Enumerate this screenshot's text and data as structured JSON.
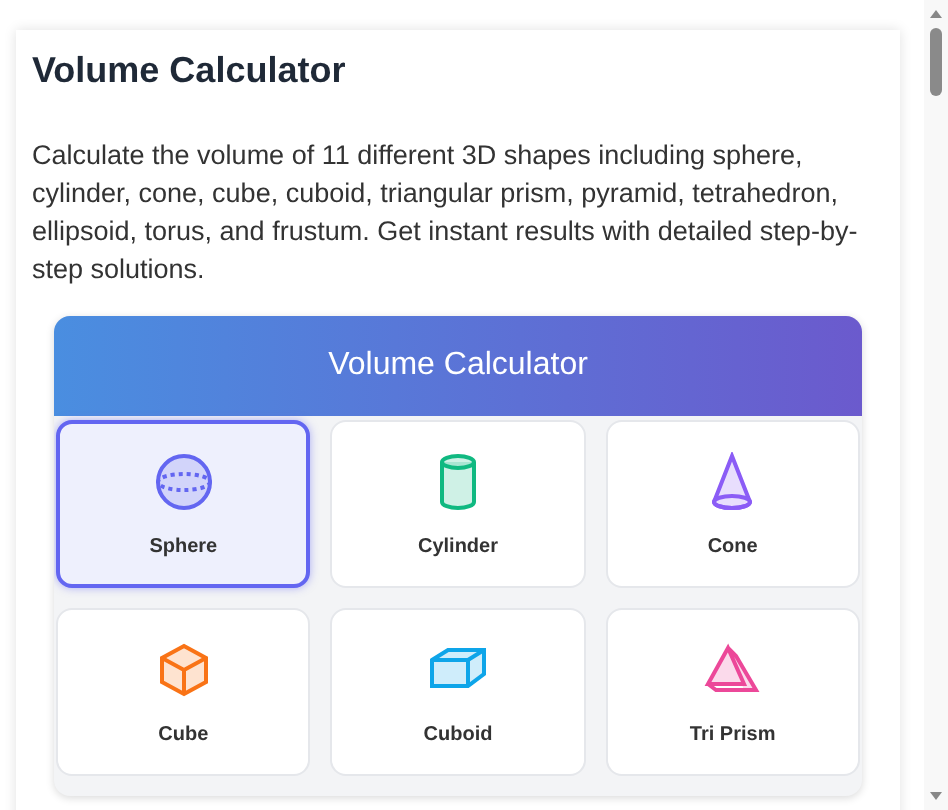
{
  "page": {
    "title": "Volume Calculator",
    "description": "Calculate the volume of 11 different 3D shapes including sphere, cylinder, cone, cube, cuboid, triangular prism, pyramid, tetrahedron, ellipsoid, torus, and frustum. Get instant results with detailed step-by-step solutions."
  },
  "calculator": {
    "title": "Volume Calculator",
    "shapes": [
      {
        "label": "Sphere",
        "kind": "sphere",
        "color": "#6366f1",
        "selected": true
      },
      {
        "label": "Cylinder",
        "kind": "cylinder",
        "color": "#10b981",
        "selected": false
      },
      {
        "label": "Cone",
        "kind": "cone",
        "color": "#8b5cf6",
        "selected": false
      },
      {
        "label": "Cube",
        "kind": "cube",
        "color": "#f97316",
        "selected": false
      },
      {
        "label": "Cuboid",
        "kind": "cuboid",
        "color": "#0ea5e9",
        "selected": false
      },
      {
        "label": "Tri Prism",
        "kind": "prism",
        "color": "#ec4899",
        "selected": false
      }
    ]
  }
}
